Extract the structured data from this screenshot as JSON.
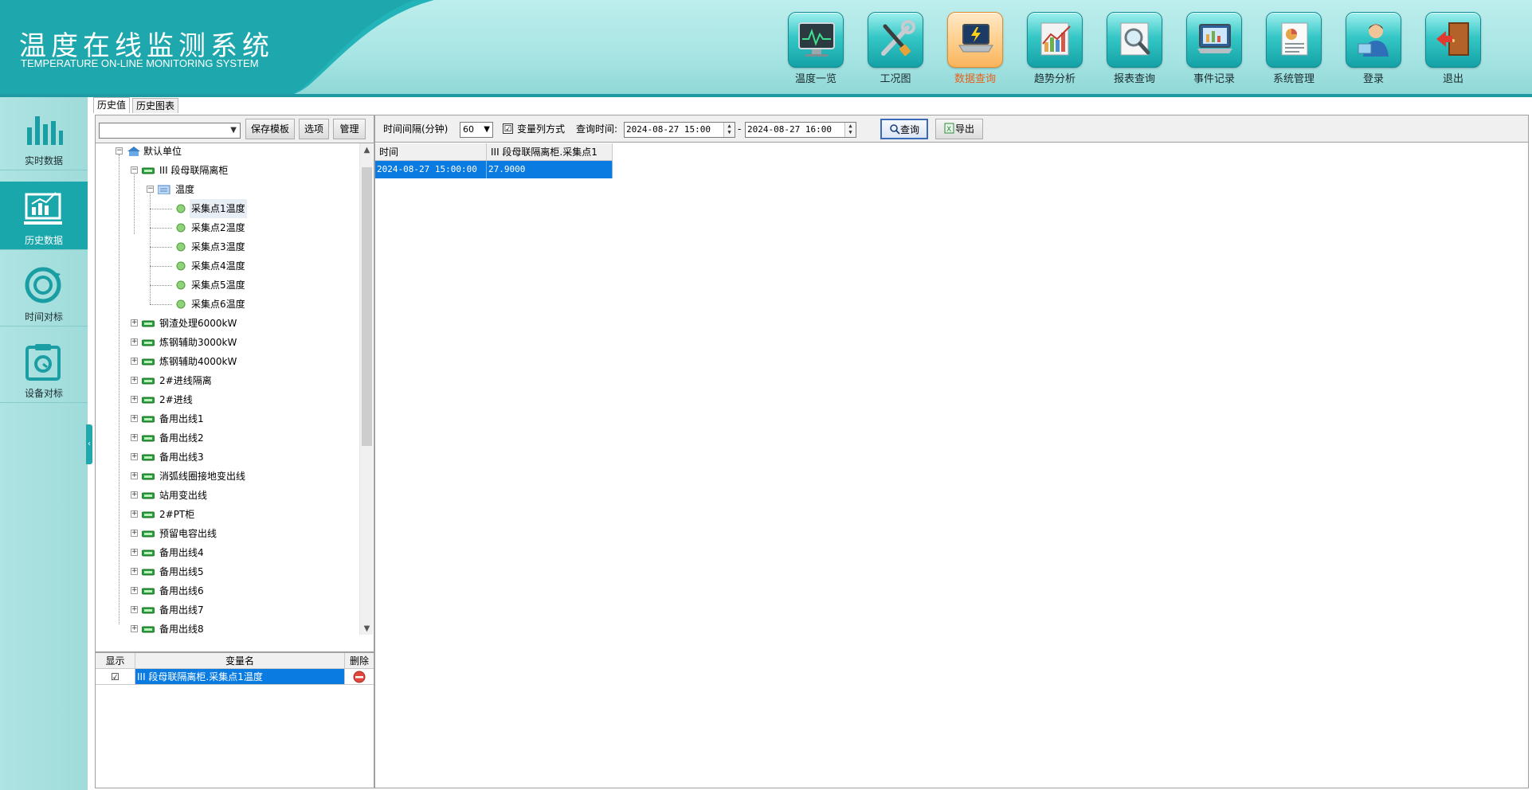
{
  "app": {
    "title": "温度在线监测系统",
    "subtitle": "TEMPERATURE ON-LINE MONITORING SYSTEM"
  },
  "top_nav": [
    {
      "label": "温度一览",
      "icon": "monitor-chart-icon",
      "active": false
    },
    {
      "label": "工况图",
      "icon": "tools-icon",
      "active": false
    },
    {
      "label": "数据查询",
      "icon": "laptop-icon",
      "active": true
    },
    {
      "label": "趋势分析",
      "icon": "trend-chart-icon",
      "active": false
    },
    {
      "label": "报表查询",
      "icon": "magnifier-report-icon",
      "active": false
    },
    {
      "label": "事件记录",
      "icon": "event-log-icon",
      "active": false
    },
    {
      "label": "系统管理",
      "icon": "system-document-icon",
      "active": false
    },
    {
      "label": "登录",
      "icon": "user-login-icon",
      "active": false
    },
    {
      "label": "退出",
      "icon": "exit-door-icon",
      "active": false
    }
  ],
  "sidebar": [
    {
      "label": "实时数据",
      "icon": "bar-chart-icon",
      "active": false
    },
    {
      "label": "历史数据",
      "icon": "history-chart-icon",
      "active": true
    },
    {
      "label": "时间对标",
      "icon": "time-sync-icon",
      "active": false
    },
    {
      "label": "设备对标",
      "icon": "device-clipboard-icon",
      "active": false
    }
  ],
  "sub_tabs": [
    "历史值",
    "历史图表"
  ],
  "template_bar": {
    "select_value": "",
    "save_label": "保存模板",
    "options_label": "选项",
    "manage_label": "管理"
  },
  "tree": {
    "root": "默认单位",
    "group": "III 段母联隔离柜",
    "folder": "温度",
    "points": [
      "采集点1温度",
      "采集点2温度",
      "采集点3温度",
      "采集点4温度",
      "采集点5温度",
      "采集点6温度"
    ],
    "devices": [
      "钢渣处理6000kW",
      "炼钢辅助3000kW",
      "炼钢辅助4000kW",
      "2#进线隔离",
      "2#进线",
      "备用出线1",
      "备用出线2",
      "备用出线3",
      "消弧线圈接地变出线",
      "站用变出线",
      "2#PT柜",
      "预留电容出线",
      "备用出线4",
      "备用出线5",
      "备用出线6",
      "备用出线7",
      "备用出线8"
    ]
  },
  "var_grid": {
    "headers": [
      "显示",
      "变量名",
      "删除"
    ],
    "rows": [
      {
        "checked": "☑",
        "name": "III 段母联隔离柜.采集点1温度"
      }
    ]
  },
  "query": {
    "interval_label": "时间间隔(分钟)",
    "interval_value": "60",
    "pivot_checked": "☑",
    "pivot_label": "变量列方式",
    "time_label": "查询时间:",
    "start_time": "2024-08-27 15:00",
    "range_sep": "-",
    "end_time": "2024-08-27 16:00",
    "query_label": "查询",
    "export_label": "导出"
  },
  "data_grid": {
    "headers": [
      "时间",
      "III 段母联隔离柜.采集点1"
    ],
    "rows": [
      [
        "2024-08-27 15:00:00",
        "27.9000"
      ]
    ]
  },
  "colors": {
    "header_teal": "#a6e4e3",
    "accent_teal": "#1aa7ac",
    "selection_blue": "#0a7be0",
    "active_orange": "#e8611a"
  }
}
